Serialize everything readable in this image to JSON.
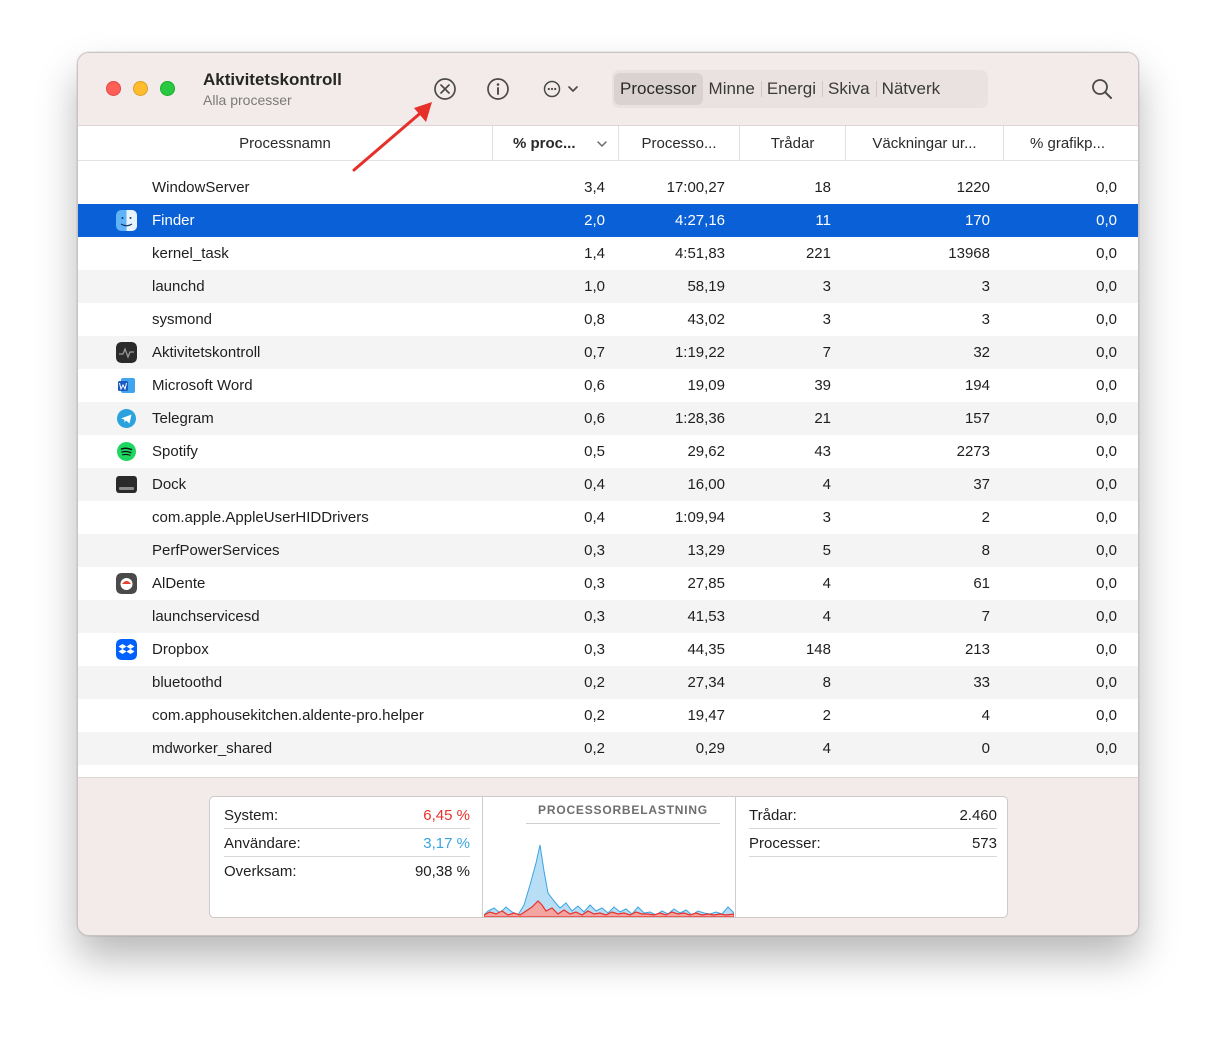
{
  "window": {
    "title": "Aktivitetskontroll",
    "subtitle": "Alla processer"
  },
  "toolbar": {
    "stop_icon": "x-circle-icon",
    "info_icon": "info-icon",
    "more_icon": "ellipsis-circle-icon",
    "tabs": [
      "Processor",
      "Minne",
      "Energi",
      "Skiva",
      "Nätverk"
    ],
    "active_tab": "Processor",
    "search_icon": "magnifier-icon"
  },
  "table": {
    "columns": [
      "Processnamn",
      "% proc...",
      "Processo...",
      "Trådar",
      "Väckningar ur...",
      "% grafikp..."
    ],
    "sorted_column": "% proc...",
    "rows": [
      {
        "name": "WindowServer",
        "icon": "",
        "cpu": "3,4",
        "time": "17:00,27",
        "threads": "18",
        "wakeups": "1220",
        "gpu": "0,0"
      },
      {
        "name": "Finder",
        "icon": "finder-icon",
        "cpu": "2,0",
        "time": "4:27,16",
        "threads": "11",
        "wakeups": "170",
        "gpu": "0,0",
        "selected": true
      },
      {
        "name": "kernel_task",
        "icon": "",
        "cpu": "1,4",
        "time": "4:51,83",
        "threads": "221",
        "wakeups": "13968",
        "gpu": "0,0"
      },
      {
        "name": "launchd",
        "icon": "",
        "cpu": "1,0",
        "time": "58,19",
        "threads": "3",
        "wakeups": "3",
        "gpu": "0,0"
      },
      {
        "name": "sysmond",
        "icon": "",
        "cpu": "0,8",
        "time": "43,02",
        "threads": "3",
        "wakeups": "3",
        "gpu": "0,0"
      },
      {
        "name": "Aktivitetskontroll",
        "icon": "activity-monitor-icon",
        "cpu": "0,7",
        "time": "1:19,22",
        "threads": "7",
        "wakeups": "32",
        "gpu": "0,0"
      },
      {
        "name": "Microsoft Word",
        "icon": "word-icon",
        "cpu": "0,6",
        "time": "19,09",
        "threads": "39",
        "wakeups": "194",
        "gpu": "0,0"
      },
      {
        "name": "Telegram",
        "icon": "telegram-icon",
        "cpu": "0,6",
        "time": "1:28,36",
        "threads": "21",
        "wakeups": "157",
        "gpu": "0,0"
      },
      {
        "name": "Spotify",
        "icon": "spotify-icon",
        "cpu": "0,5",
        "time": "29,62",
        "threads": "43",
        "wakeups": "2273",
        "gpu": "0,0"
      },
      {
        "name": "Dock",
        "icon": "dock-icon",
        "cpu": "0,4",
        "time": "16,00",
        "threads": "4",
        "wakeups": "37",
        "gpu": "0,0"
      },
      {
        "name": "com.apple.AppleUserHIDDrivers",
        "icon": "",
        "cpu": "0,4",
        "time": "1:09,94",
        "threads": "3",
        "wakeups": "2",
        "gpu": "0,0"
      },
      {
        "name": "PerfPowerServices",
        "icon": "",
        "cpu": "0,3",
        "time": "13,29",
        "threads": "5",
        "wakeups": "8",
        "gpu": "0,0"
      },
      {
        "name": "AlDente",
        "icon": "aldente-icon",
        "cpu": "0,3",
        "time": "27,85",
        "threads": "4",
        "wakeups": "61",
        "gpu": "0,0"
      },
      {
        "name": "launchservicesd",
        "icon": "",
        "cpu": "0,3",
        "time": "41,53",
        "threads": "4",
        "wakeups": "7",
        "gpu": "0,0"
      },
      {
        "name": "Dropbox",
        "icon": "dropbox-icon",
        "cpu": "0,3",
        "time": "44,35",
        "threads": "148",
        "wakeups": "213",
        "gpu": "0,0"
      },
      {
        "name": "bluetoothd",
        "icon": "",
        "cpu": "0,2",
        "time": "27,34",
        "threads": "8",
        "wakeups": "33",
        "gpu": "0,0"
      },
      {
        "name": "com.apphousekitchen.aldente-pro.helper",
        "icon": "",
        "cpu": "0,2",
        "time": "19,47",
        "threads": "2",
        "wakeups": "4",
        "gpu": "0,0"
      },
      {
        "name": "mdworker_shared",
        "icon": "",
        "cpu": "0,2",
        "time": "0,29",
        "threads": "4",
        "wakeups": "0",
        "gpu": "0,0"
      }
    ]
  },
  "summary": {
    "system_label": "System:",
    "system_value": "6,45 %",
    "user_label": "Användare:",
    "user_value": "3,17 %",
    "idle_label": "Overksam:",
    "idle_value": "90,38 %",
    "chart_title": "PROCESSORBELASTNING",
    "threads_label": "Trådar:",
    "threads_value": "2.460",
    "processes_label": "Processer:",
    "processes_value": "573"
  },
  "colors": {
    "selection": "#0a60d6",
    "system": "#e8312b",
    "user": "#3aa4e0",
    "annotation_arrow": "#e6302a"
  }
}
